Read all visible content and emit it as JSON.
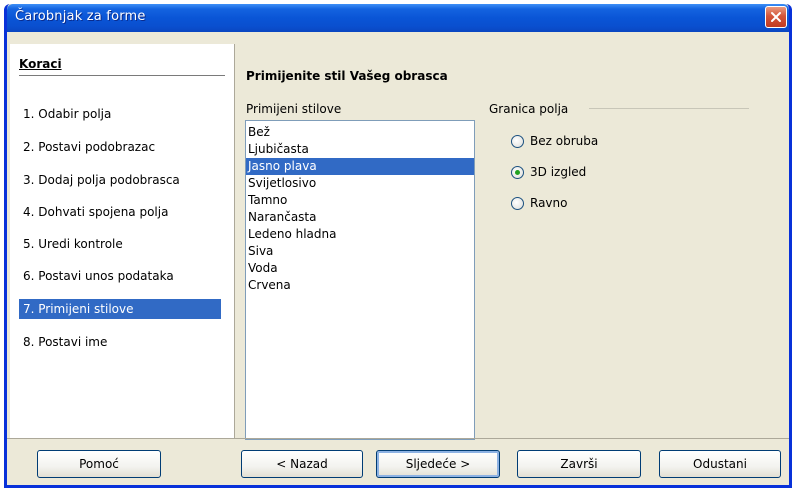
{
  "window": {
    "title": "Čarobnjak za forme"
  },
  "steps": {
    "title": "Koraci",
    "items": [
      {
        "label": "1. Odabir polja"
      },
      {
        "label": "2. Postavi podobrazac"
      },
      {
        "label": "3. Dodaj polja podobrasca"
      },
      {
        "label": "4. Dohvati spojena polja"
      },
      {
        "label": "5. Uredi kontrole"
      },
      {
        "label": "6. Postavi unos podataka"
      },
      {
        "label": "7. Primijeni stilove"
      },
      {
        "label": "8. Postavi ime"
      }
    ],
    "active_index": 6
  },
  "page": {
    "title": "Primijenite stil Vašeg obrasca",
    "styles_label": "Primijeni stilove",
    "styles": [
      "Bež",
      "Ljubičasta",
      "Jasno plava",
      "Svijetlosivo",
      "Tamno",
      "Narančasta",
      "Ledeno hladna",
      "Siva",
      "Voda",
      "Crvena"
    ],
    "selected_style": "Jasno plava",
    "border_label": "Granica polja",
    "border_options": [
      {
        "label": "Bez obruba",
        "checked": false
      },
      {
        "label": "3D izgled",
        "checked": true
      },
      {
        "label": "Ravno",
        "checked": false
      }
    ]
  },
  "buttons": {
    "help": "Pomoć",
    "back": "< Nazad",
    "next": "Sljedeće >",
    "finish": "Završi",
    "cancel": "Odustani"
  },
  "colors": {
    "selection": "#316ac5",
    "title_bar": "#0a55d6",
    "dialog_bg": "#ece9d8"
  }
}
